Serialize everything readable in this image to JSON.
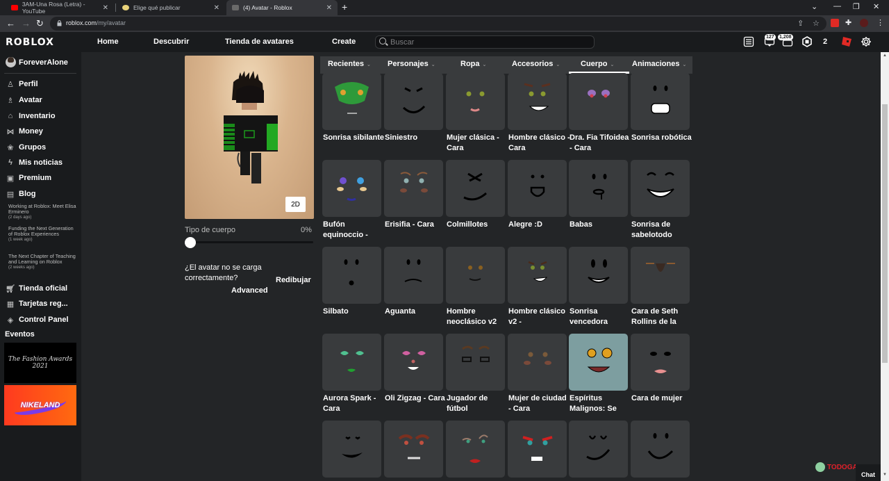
{
  "browser": {
    "tabs": [
      {
        "title": "3AM-Una Rosa (Letra) - YouTube",
        "favicon": "youtube-icon",
        "active": false
      },
      {
        "title": "Elige qué publicar",
        "favicon": "emoji-icon",
        "active": false
      },
      {
        "title": "(4) Avatar - Roblox",
        "favicon": "roblox-icon",
        "active": true
      }
    ],
    "new_tab": "+",
    "url_host": "roblox.com",
    "url_path": "/my/avatar",
    "window_controls": {
      "tabsearch": "⌄",
      "minimize": "—",
      "restore": "❐",
      "close": "✕"
    }
  },
  "header": {
    "logo": "ROBLOX",
    "nav": [
      "Home",
      "Descubrir",
      "Tienda de avatares",
      "Create"
    ],
    "search_placeholder": "Buscar",
    "notifications_badge": "127",
    "friends_badge": "1,208",
    "robux": "2"
  },
  "sidebar": {
    "username": "ForeverAlone",
    "items": [
      {
        "label": "Perfil",
        "icon": "profile-icon"
      },
      {
        "label": "Avatar",
        "icon": "avatar-icon"
      },
      {
        "label": "Inventario",
        "icon": "inventory-icon"
      },
      {
        "label": "Money",
        "icon": "money-icon"
      },
      {
        "label": "Grupos",
        "icon": "groups-icon"
      },
      {
        "label": "Mis noticias",
        "icon": "news-icon"
      },
      {
        "label": "Premium",
        "icon": "premium-icon"
      },
      {
        "label": "Blog",
        "icon": "blog-icon"
      }
    ],
    "blog_posts": [
      {
        "title": "Working at Roblox: Meet Elisa Erminero",
        "ago": "(2 days ago)"
      },
      {
        "title": "Funding the Next Generation of Roblox Experiences",
        "ago": "(1 week ago)"
      },
      {
        "title": "The Next Chapter of Teaching and Learning on Roblox",
        "ago": "(2 weeks ago)"
      }
    ],
    "bottom_items": [
      {
        "label": "Tienda oficial",
        "icon": "shop-icon"
      },
      {
        "label": "Tarjetas reg...",
        "icon": "gift-card-icon"
      },
      {
        "label": "Control Panel",
        "icon": "control-panel-icon"
      }
    ],
    "events_title": "Eventos",
    "events": [
      {
        "label": "The Fashion Awards 2021"
      },
      {
        "label": "NIKELAND"
      }
    ]
  },
  "avatar": {
    "toggle_2d": "2D",
    "body_type_label": "Tipo de cuerpo",
    "body_type_value": "0%",
    "body_type_fraction": 0,
    "redraw_question": "¿El avatar no se carga correctamente?",
    "redraw_button": "Redibujar",
    "advanced": "Advanced"
  },
  "category_tabs": [
    {
      "label": "Recientes",
      "active": false
    },
    {
      "label": "Personajes",
      "active": false
    },
    {
      "label": "Ropa",
      "active": false
    },
    {
      "label": "Accesorios",
      "active": false
    },
    {
      "label": "Cuerpo",
      "active": true
    },
    {
      "label": "Animaciones",
      "active": false
    }
  ],
  "items": [
    {
      "name": "Sonrisa sibilante",
      "face": "snake"
    },
    {
      "name": "Siniestro",
      "face": "sinister"
    },
    {
      "name": "Mujer clásica - Cara",
      "face": "classic-woman"
    },
    {
      "name": "Hombre clásico - Cara",
      "face": "classic-man"
    },
    {
      "name": "Dra. Fia Tifoidea - Cara",
      "face": "tired"
    },
    {
      "name": "Sonrisa robótica",
      "face": "robot"
    },
    {
      "name": "Bufón equinoccio -",
      "face": "jester"
    },
    {
      "name": "Erisifia - Cara",
      "face": "erisifia"
    },
    {
      "name": "Colmillotes",
      "face": "fangs"
    },
    {
      "name": "Alegre :D",
      "face": "happy-d"
    },
    {
      "name": "Babas",
      "face": "drool"
    },
    {
      "name": "Sonrisa de sabelotodo",
      "face": "smug"
    },
    {
      "name": "Silbato",
      "face": "whistle"
    },
    {
      "name": "Aguanta",
      "face": "hold"
    },
    {
      "name": "Hombre neoclásico v2",
      "face": "neoclassic"
    },
    {
      "name": "Hombre clásico v2 -",
      "face": "classic-v2"
    },
    {
      "name": "Sonrisa vencedora",
      "face": "winning"
    },
    {
      "name": "Cara de Seth Rollins de la",
      "face": "seth"
    },
    {
      "name": "Aurora Spark - Cara",
      "face": "aurora"
    },
    {
      "name": "Oli Zigzag - Cara",
      "face": "oli"
    },
    {
      "name": "Jugador de fútbol",
      "face": "football"
    },
    {
      "name": "Mujer de ciudad - Cara",
      "face": "city-woman"
    },
    {
      "name": "Espíritus Malignos: Se",
      "face": "spirit"
    },
    {
      "name": "Cara de mujer",
      "face": "woman"
    },
    {
      "name": "",
      "face": "smile"
    },
    {
      "name": "",
      "face": "angry-woman"
    },
    {
      "name": "",
      "face": "lipstick"
    },
    {
      "name": "",
      "face": "red-brows"
    },
    {
      "name": "",
      "face": "sly"
    },
    {
      "name": "",
      "face": "tongue"
    }
  ],
  "chat_label": "Chat",
  "watermark": "TODOGADGET"
}
